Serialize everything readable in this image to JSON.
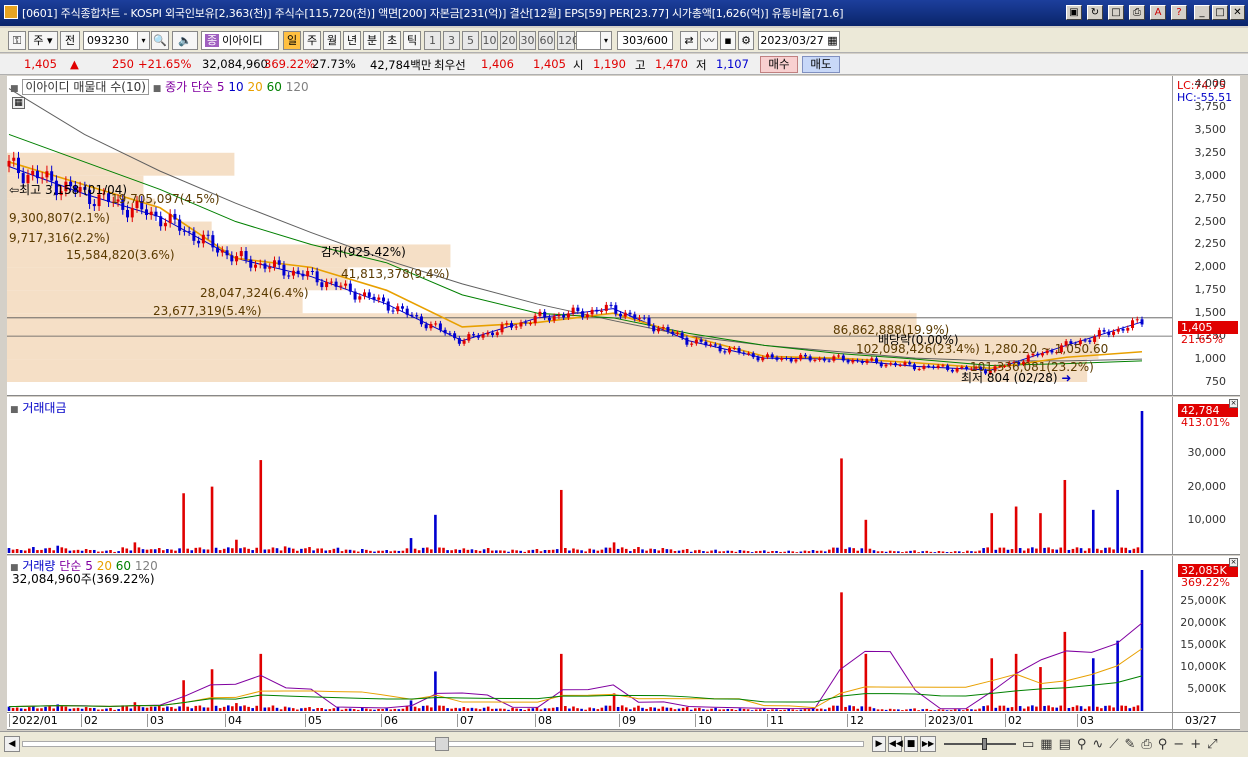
{
  "window": {
    "title": "[0601] 주식종합차트 - KOSPI 외국인보유[2,363(천)] 주식수[115,720(천)] 액면[200] 자본금[231(억)] 결산[12월] EPS[59] PER[23.77] 시가총액[1,626(억)] 유통비율[71.6]"
  },
  "toolbar": {
    "market": "주",
    "prev_label": "전",
    "code": "093230",
    "stock_name": "이아이디",
    "buttons": [
      "일",
      "주",
      "월",
      "년",
      "분",
      "초",
      "틱"
    ],
    "intervals": [
      "1",
      "3",
      "5",
      "10",
      "20",
      "30",
      "60",
      "120"
    ],
    "count": "303",
    "count_total": "/600",
    "date": "2023/03/27"
  },
  "quote": {
    "price": "1,405",
    "arrow": "▲",
    "change": "250",
    "change_pct": "+21.65%",
    "volume": "32,084,960",
    "volume_pct": "369.22%",
    "turnover": "27.73%",
    "amount": "42,784백만",
    "best_ask_label": "최우선",
    "ask": "1,406",
    "bid": "1,405",
    "open_label": "시",
    "open": "1,190",
    "high_label": "고",
    "high": "1,470",
    "low_label": "저",
    "low": "1,107",
    "buy_label": "매수",
    "sell_label": "매도"
  },
  "price_pane": {
    "header_name": "이아이디 매물대 수(10)",
    "ma_label": "종가 단순",
    "ma_periods": [
      "5",
      "10",
      "20",
      "60",
      "120"
    ],
    "lc": "LC:74.75",
    "hc": "HC:-55.51",
    "current_price_box": "1,405",
    "current_pct": "21.65%",
    "annotations": {
      "high": "최고 3,158 (01/04)",
      "low": "최저 804 (02/28)",
      "capital_reduction": "감자(925.42%)",
      "dividend": "배당락(0.00%)",
      "range": "1,280.20 ~ 1,050.60"
    },
    "volume_profile_labels": [
      "19,705,097(4.5%)",
      "9,300,807(2.1%)",
      "9,717,316(2.2%)",
      "15,584,820(3.6%)",
      "41,813,378(9.4%)",
      "28,047,324(6.4%)",
      "23,677,319(5.4%)",
      "86,862,888(19.9%)",
      "102,098,426(23.4%)",
      "101,336,081(23.2%)"
    ]
  },
  "amount_pane": {
    "title": "거래대금",
    "value_box": "42,784",
    "value_pct": "413.01%"
  },
  "volume_pane": {
    "title": "거래량",
    "ma_label": "단순",
    "ma_periods": [
      "5",
      "20",
      "60",
      "120"
    ],
    "info": "32,084,960주(369.22%)",
    "value_box": "32,085K",
    "value_pct": "369.22%"
  },
  "x_axis": {
    "labels": [
      "2022/01",
      "02",
      "03",
      "04",
      "05",
      "06",
      "07",
      "08",
      "09",
      "10",
      "11",
      "12",
      "2023/01",
      "02",
      "03"
    ],
    "end_label": "03/27"
  },
  "chart_data": [
    {
      "type": "line",
      "title": "이아이디 매물대 수(10)",
      "ylim": [
        750,
        4000
      ],
      "y_ticks": [
        4000,
        3750,
        3500,
        3250,
        3000,
        2750,
        2500,
        2250,
        2000,
        1750,
        1500,
        1250,
        1000,
        750
      ],
      "x": [
        "2022/01",
        "02",
        "03",
        "04",
        "05",
        "06",
        "07",
        "08",
        "09",
        "10",
        "11",
        "12",
        "2023/01",
        "02",
        "03",
        "03/27"
      ],
      "series": [
        {
          "name": "종가",
          "values": [
            3100,
            2800,
            2550,
            2100,
            1900,
            1600,
            1200,
            1450,
            1550,
            1200,
            1010,
            1000,
            920,
            880,
            1150,
            1405
          ]
        },
        {
          "name": "120",
          "values": [
            3950,
            3450,
            3050,
            2700,
            2380,
            2080,
            1820,
            1600,
            1420,
            1250,
            1150,
            1080,
            1010,
            980,
            980,
            1000
          ]
        },
        {
          "name": "60",
          "values": [
            3450,
            3150,
            2850,
            2500,
            2250,
            2050,
            1700,
            1500,
            1450,
            1280,
            1150,
            1060,
            1000,
            930,
            950,
            980
          ]
        },
        {
          "name": "20",
          "values": [
            3150,
            2900,
            2650,
            2100,
            2000,
            1750,
            1350,
            1400,
            1500,
            1250,
            1030,
            1010,
            960,
            900,
            1020,
            1080
          ]
        }
      ]
    },
    {
      "type": "bar",
      "title": "거래대금",
      "ylim": [
        0,
        42784
      ],
      "y_ticks": [
        30000,
        20000,
        10000
      ],
      "values": [
        1500,
        1800,
        2200,
        1200,
        900,
        3200,
        1500,
        18000,
        20000,
        4000,
        28000,
        2000,
        1800,
        1600,
        1200,
        900,
        4500,
        11500,
        1400,
        1500,
        1000,
        1200,
        19000,
        1300,
        3200,
        1800,
        1500,
        1200,
        1000,
        900,
        800,
        700,
        900,
        28500,
        10000,
        700,
        800,
        600,
        700,
        12000,
        14000,
        12000,
        22000,
        13000,
        19000,
        42784
      ]
    },
    {
      "type": "bar",
      "title": "거래량",
      "ylim": [
        0,
        32085
      ],
      "y_ticks": [
        25000,
        20000,
        15000,
        10000,
        5000
      ],
      "values": [
        1000,
        1200,
        1500,
        900,
        700,
        2000,
        1300,
        7000,
        9500,
        1800,
        13000,
        1000,
        900,
        800,
        700,
        600,
        2400,
        9000,
        900,
        1000,
        700,
        800,
        13000,
        800,
        4000,
        1200,
        1000,
        900,
        700,
        600,
        500,
        500,
        700,
        27000,
        13000,
        500,
        600,
        400,
        500,
        12000,
        13000,
        10000,
        18000,
        12000,
        16000,
        32085
      ]
    }
  ],
  "colors": {
    "up": "#e00000",
    "down": "#0000d0",
    "ma5": "#8000a0",
    "ma10": "#0000c8",
    "ma20": "#e8a000",
    "ma60": "#008000",
    "ma120": "#606060",
    "profile": "#f4dcc0"
  }
}
